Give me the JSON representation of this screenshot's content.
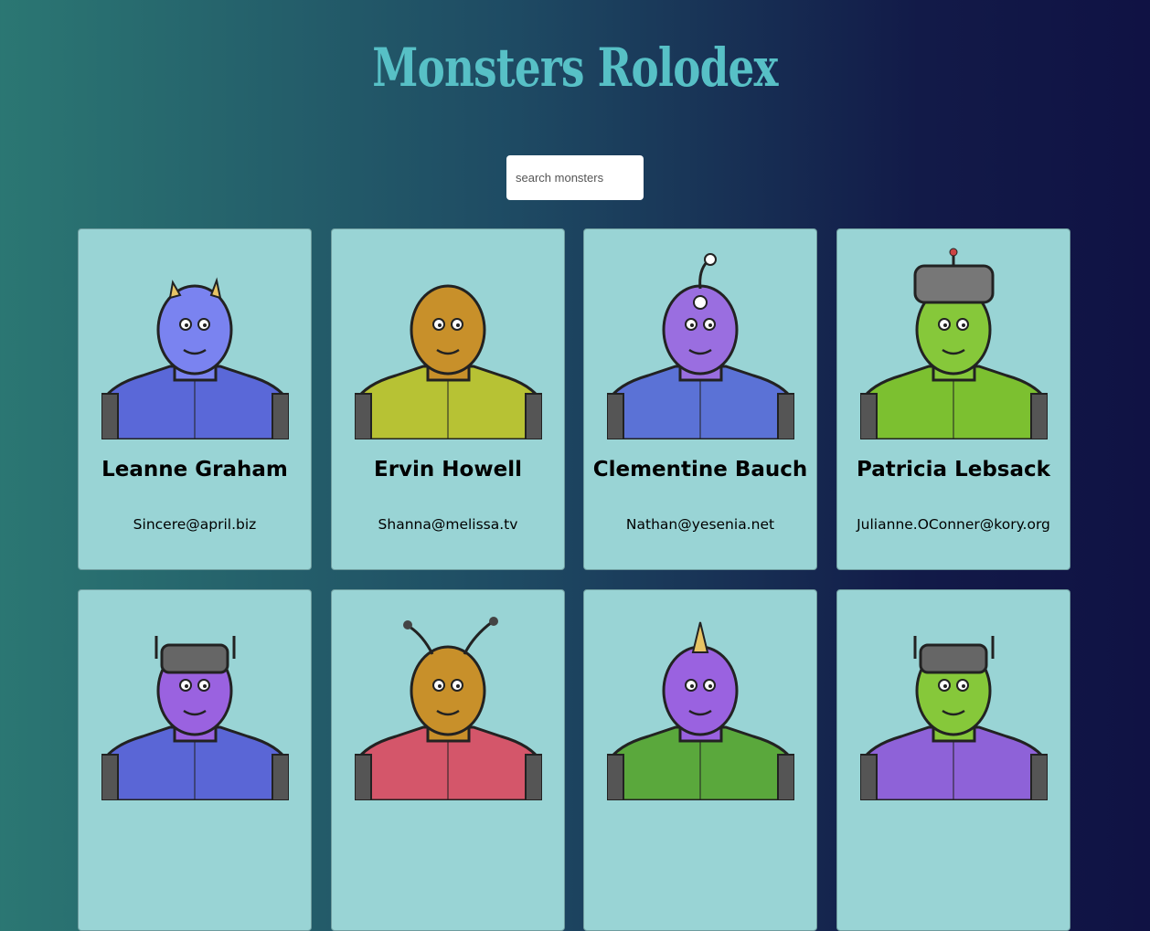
{
  "app": {
    "title": "Monsters Rolodex"
  },
  "search": {
    "placeholder": "search monsters"
  },
  "monsters": [
    {
      "name": "Leanne Graham",
      "email": "Sincere@april.biz",
      "skin": "#7a83f0",
      "body": "#5a68d8",
      "head": "horn"
    },
    {
      "name": "Ervin Howell",
      "email": "Shanna@melissa.tv",
      "skin": "#c8902a",
      "body": "#b7c234",
      "head": "plain"
    },
    {
      "name": "Clementine Bauch",
      "email": "Nathan@yesenia.net",
      "skin": "#9a6ee0",
      "body": "#5b72d6",
      "head": "eyestalk"
    },
    {
      "name": "Patricia Lebsack",
      "email": "Julianne.OConner@kory.org",
      "skin": "#86c83a",
      "body": "#7cc030",
      "head": "helmet"
    },
    {
      "name": "",
      "email": "",
      "skin": "#9a62e0",
      "body": "#5a66d6",
      "head": "robot"
    },
    {
      "name": "",
      "email": "",
      "skin": "#c8902a",
      "body": "#d4566a",
      "head": "antenna"
    },
    {
      "name": "",
      "email": "",
      "skin": "#9a62e0",
      "body": "#5aa83c",
      "head": "unihorn"
    },
    {
      "name": "",
      "email": "",
      "skin": "#86c83a",
      "body": "#8e62d8",
      "head": "robot"
    }
  ]
}
